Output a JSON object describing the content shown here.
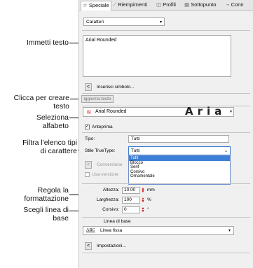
{
  "callouts": {
    "immetti_testo": "Immetti testo",
    "clicca_line1": "Clicca per creare",
    "clicca_line2": "testo",
    "seleziona_line1": "Seleziona",
    "seleziona_line2": "alfabeto",
    "filtra_line1": "Filtra l'elenco tipi",
    "filtra_line2": "di carattere",
    "regola_line1": "Regola la",
    "regola_line2": "formattazione",
    "scegli_line1": "Scegli linea di",
    "scegli_line2": "base"
  },
  "tabs": [
    "Speciale",
    "Riempimenti",
    "Profili",
    "Sottopunto",
    "Conn"
  ],
  "panel": {
    "category_select": "Caratteri",
    "text_value": "Arial Rounded",
    "insert_symbol_btn": "<",
    "insert_symbol_label": "Inserisci simbolo...",
    "create_text_btn": "iggiorna testo",
    "alphabet_name": "Arial Rounded",
    "alphabet_preview": "Aria",
    "preview_label": "Anteprima",
    "tipo_label": "Tipo:",
    "tipo_value": "Tutti",
    "stile_label": "Stile TrueType:",
    "stile_value": "Tutti",
    "stile_options": [
      "Tutti",
      "Blocco",
      "Serif",
      "Corsivo",
      "Ornamentale"
    ],
    "conversion_btn": "<",
    "conversion_label": "Conversione",
    "usa_versione_label": "Usa versione",
    "altezza_label": "Altezza:",
    "altezza_value": "10.00",
    "altezza_unit": "mm",
    "larghezza_label": "Larghezza:",
    "larghezza_value": "100",
    "larghezza_unit": "%",
    "corsivo_label": "Corsivo:",
    "corsivo_value": "0",
    "corsivo_unit": "°",
    "baseline_section": "Linea di base",
    "baseline_icon_text": "ABC",
    "baseline_value": "Linea fissa",
    "settings_btn": "<",
    "settings_label": "Impostazioni..."
  }
}
